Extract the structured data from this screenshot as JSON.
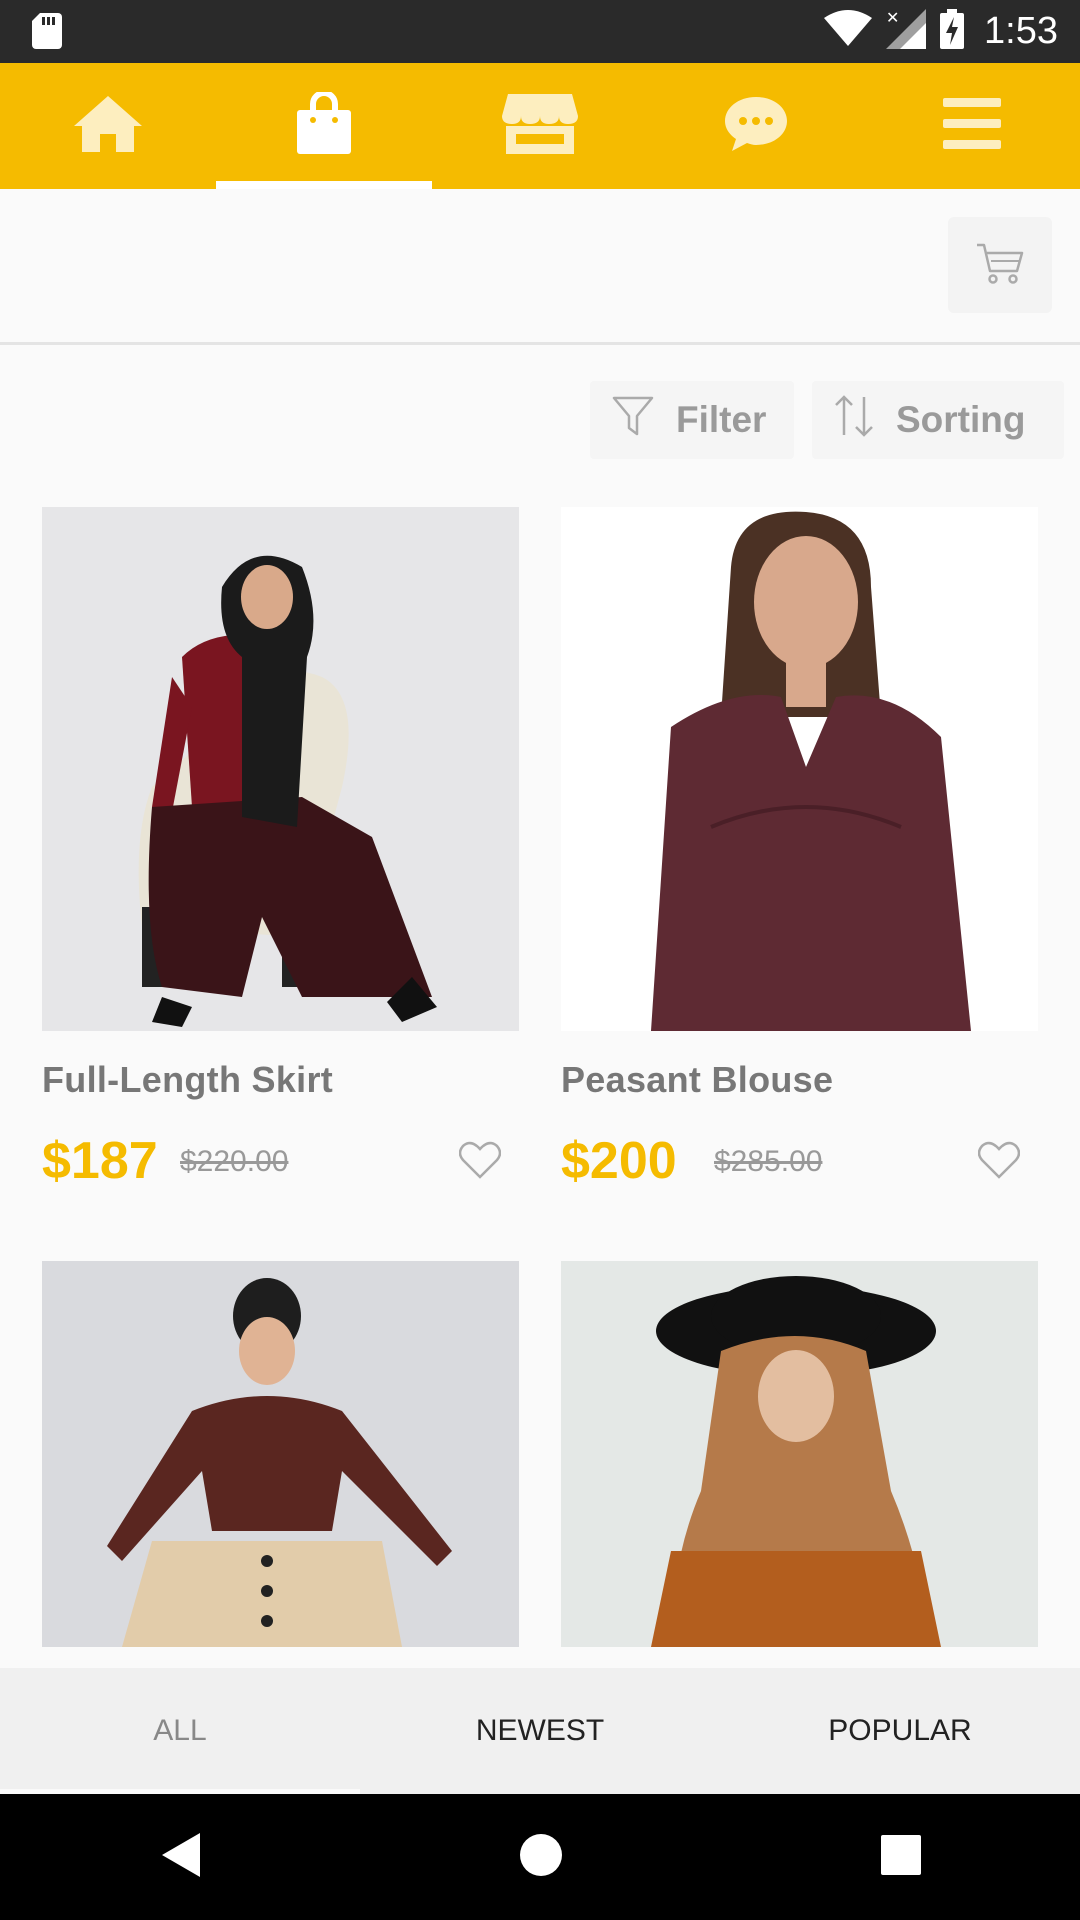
{
  "status_bar": {
    "time": "1:53"
  },
  "top_nav": {
    "items": [
      {
        "icon": "home-icon",
        "active": false
      },
      {
        "icon": "shopping-bag-icon",
        "active": true
      },
      {
        "icon": "store-icon",
        "active": false
      },
      {
        "icon": "chat-icon",
        "active": false
      },
      {
        "icon": "menu-icon",
        "active": false
      }
    ]
  },
  "toolbar": {
    "filter_label": "Filter",
    "sorting_label": "Sorting"
  },
  "products": [
    {
      "name": "Full-Length Skirt",
      "price": "$187",
      "old_price": "$220.00"
    },
    {
      "name": "Peasant Blouse",
      "price": "$200",
      "old_price": "$285.00"
    },
    {
      "name": "",
      "price": "",
      "old_price": ""
    },
    {
      "name": "",
      "price": "",
      "old_price": ""
    }
  ],
  "bottom_tabs": {
    "all": "ALL",
    "newest": "NEWEST",
    "popular": "POPULAR"
  },
  "colors": {
    "accent": "#f5bb00",
    "status_bar": "#2a2a2a",
    "background": "#fafafa"
  }
}
